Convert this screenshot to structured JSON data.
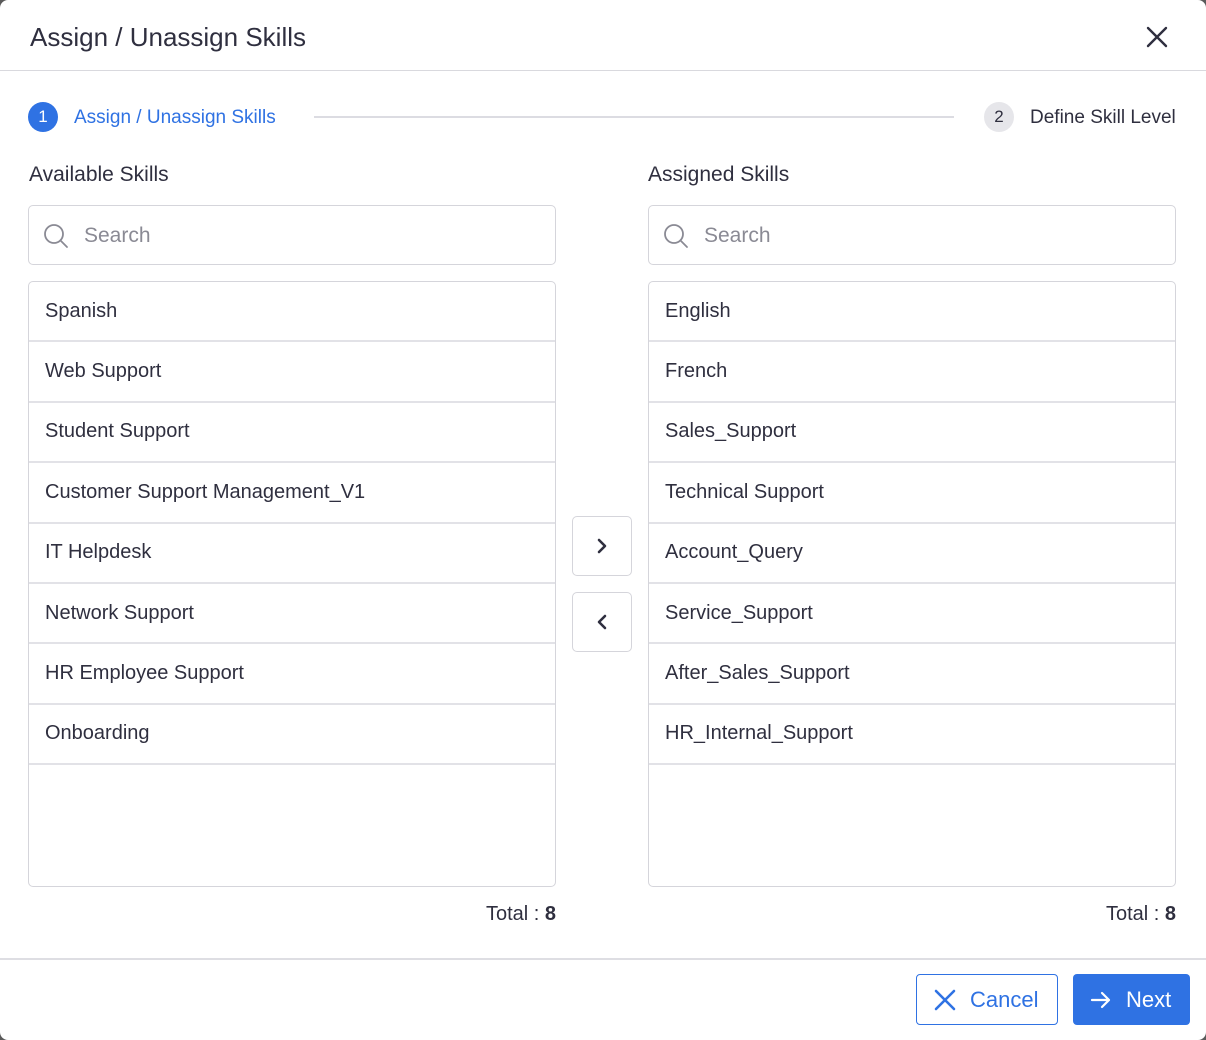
{
  "dialog": {
    "title": "Assign / Unassign Skills",
    "close_icon": "close-icon"
  },
  "stepper": {
    "steps": [
      {
        "number": "1",
        "label": "Assign / Unassign Skills",
        "state": "active"
      },
      {
        "number": "2",
        "label": "Define Skill Level",
        "state": "inactive"
      }
    ]
  },
  "available": {
    "title": "Available Skills",
    "search_placeholder": "Search",
    "search_value": "",
    "items": [
      "Spanish",
      "Web Support",
      "Student Support",
      "Customer Support Management_V1",
      "IT Helpdesk",
      "Network Support",
      "HR Employee Support",
      "Onboarding"
    ],
    "total_label": "Total : ",
    "total_value": "8"
  },
  "assigned": {
    "title": "Assigned Skills",
    "search_placeholder": "Search",
    "search_value": "",
    "items": [
      "English",
      "French",
      "Sales_Support",
      "Technical Support",
      "Account_Query",
      "Service_Support",
      "After_Sales_Support",
      "HR_Internal_Support"
    ],
    "total_label": "Total : ",
    "total_value": "8"
  },
  "transfer": {
    "assign_icon": "chevron-right-icon",
    "unassign_icon": "chevron-left-icon"
  },
  "footer": {
    "cancel_label": "Cancel",
    "next_label": "Next"
  },
  "colors": {
    "primary": "#2f72e3",
    "text": "#2f2f3f",
    "border": "#d5d5db"
  }
}
